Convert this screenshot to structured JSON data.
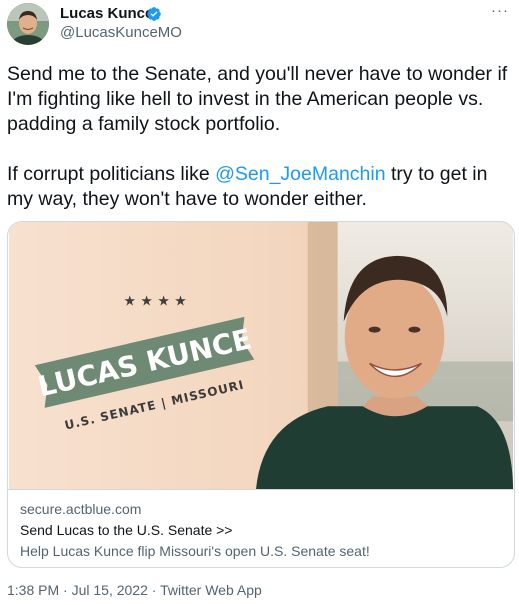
{
  "author": {
    "display_name": "Lucas Kunce",
    "handle": "@LucasKunceMO",
    "verified_icon": "verified-badge-icon",
    "avatar_icon": "user-avatar"
  },
  "more_icon": "more-options-icon",
  "more_label": "···",
  "tweet": {
    "paragraph1": "Send me to the Senate, and you'll never have to wonder if I'm fighting like hell to invest in the American people vs. padding a family stock portfolio.",
    "paragraph2_before": "If corrupt politicians like ",
    "mention": "@Sen_JoeManchin",
    "paragraph2_after": " try to get in my way, they won't have to wonder either."
  },
  "card": {
    "image": {
      "stars": "★ ★ ★ ★",
      "banner_name": "LUCAS KUNCE",
      "banner_subtitle": "U.S. SENATE | MISSOURI"
    },
    "domain": "secure.actblue.com",
    "title": "Send Lucas to the U.S. Senate >>",
    "description": "Help Lucas Kunce flip Missouri's open U.S. Senate seat!"
  },
  "meta": {
    "time": "1:38 PM",
    "separator": " · ",
    "date": "Jul 15, 2022",
    "source": "Twitter Web App"
  },
  "colors": {
    "accent": "#1d9bf0",
    "banner_green": "#6f8a74",
    "shirt_green": "#1f3d33",
    "background_peach": "#f6dcc7"
  }
}
